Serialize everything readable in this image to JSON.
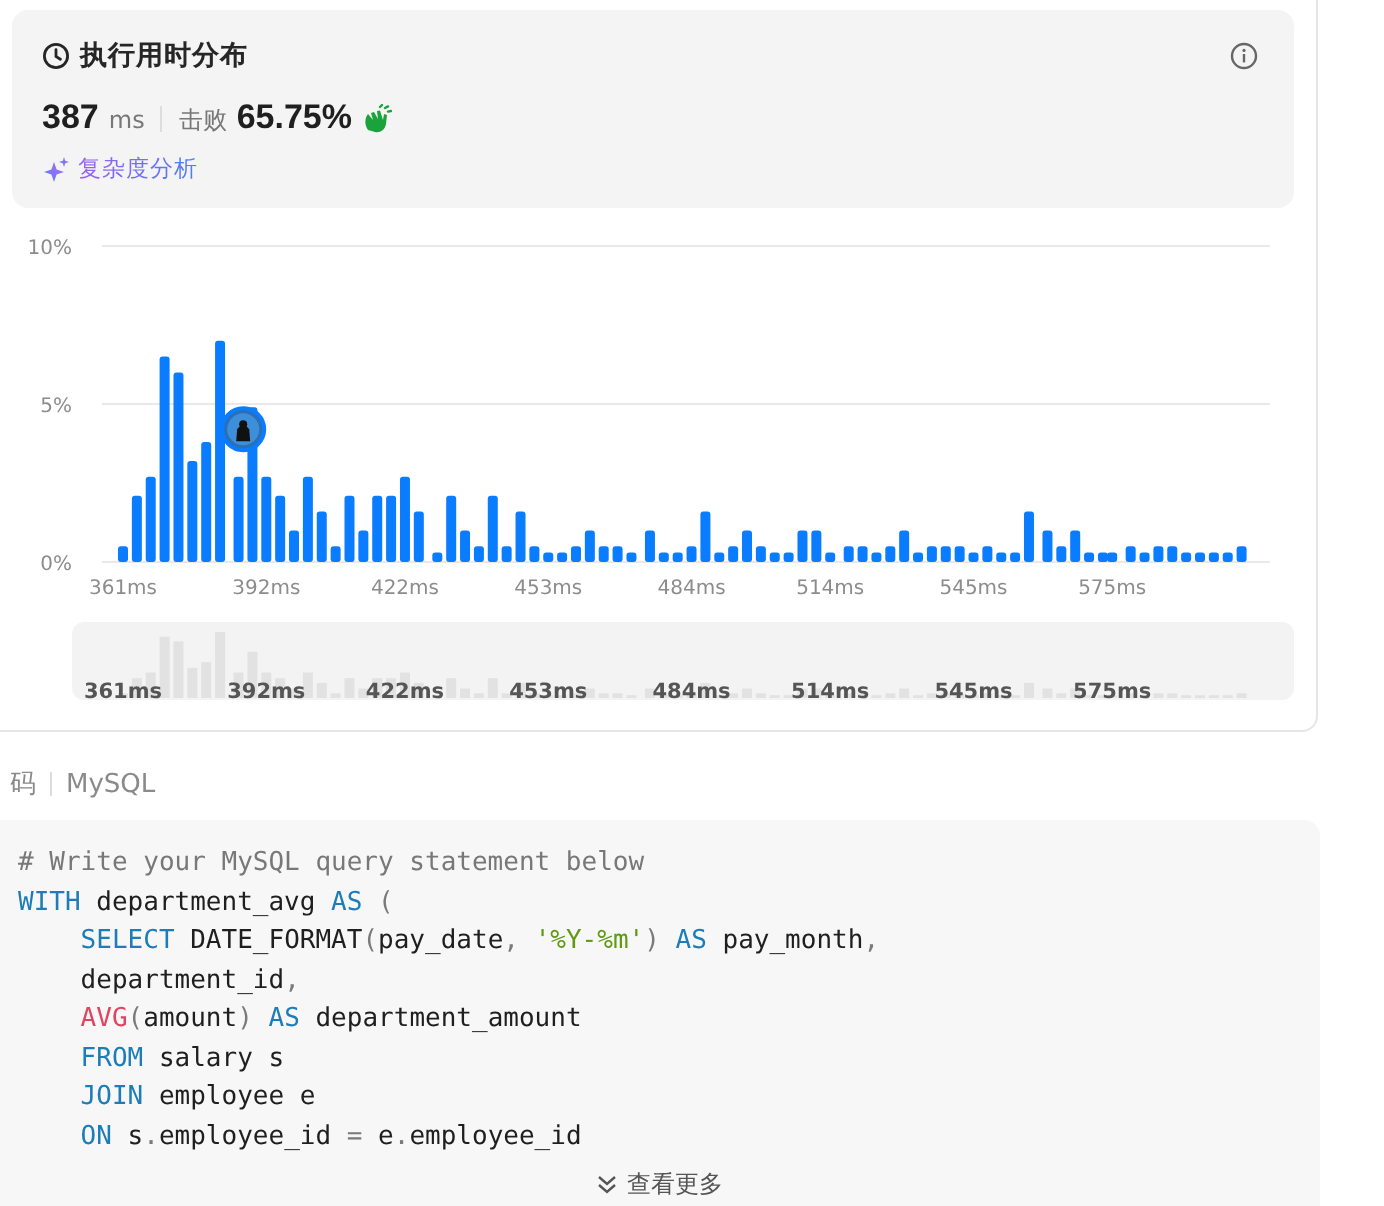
{
  "runtime_panel": {
    "title": "执行用时分布",
    "runtime": "387",
    "unit": "ms",
    "beats_label": "击败",
    "beats": "65.75%",
    "analysis_link": "复杂度分析"
  },
  "chart_data": {
    "type": "bar",
    "yticks": [
      {
        "value": 0,
        "label": "0%"
      },
      {
        "value": 5,
        "label": "5%"
      },
      {
        "value": 10,
        "label": "10%"
      }
    ],
    "ylim": [
      0,
      10
    ],
    "xlim": [
      361,
      603
    ],
    "xticks": [
      {
        "value": 361,
        "label": "361ms"
      },
      {
        "value": 392,
        "label": "392ms"
      },
      {
        "value": 422,
        "label": "422ms"
      },
      {
        "value": 453,
        "label": "453ms"
      },
      {
        "value": 484,
        "label": "484ms"
      },
      {
        "value": 514,
        "label": "514ms"
      },
      {
        "value": 545,
        "label": "545ms"
      },
      {
        "value": 575,
        "label": "575ms"
      }
    ],
    "x": [
      361,
      364,
      367,
      370,
      373,
      376,
      379,
      382,
      386,
      389,
      392,
      395,
      398,
      401,
      404,
      407,
      410,
      413,
      416,
      419,
      422,
      425,
      429,
      432,
      435,
      438,
      441,
      444,
      447,
      450,
      453,
      456,
      459,
      462,
      465,
      468,
      471,
      475,
      478,
      481,
      484,
      487,
      490,
      493,
      496,
      499,
      502,
      505,
      508,
      511,
      514,
      518,
      521,
      524,
      527,
      530,
      533,
      536,
      539,
      542,
      545,
      548,
      551,
      554,
      557,
      561,
      564,
      567,
      570,
      573,
      575,
      579,
      582,
      585,
      588,
      591,
      594,
      597,
      600,
      603
    ],
    "values": [
      0.5,
      2.1,
      2.7,
      6.5,
      6.0,
      3.2,
      3.8,
      7.0,
      2.7,
      4.9,
      2.7,
      2.1,
      1.0,
      2.7,
      1.6,
      0.5,
      2.1,
      1.0,
      2.1,
      2.1,
      2.7,
      1.6,
      0.3,
      2.1,
      1.0,
      0.5,
      2.1,
      0.5,
      1.6,
      0.5,
      0.3,
      0.3,
      0.5,
      1.0,
      0.5,
      0.5,
      0.3,
      1.0,
      0.3,
      0.3,
      0.5,
      1.6,
      0.3,
      0.5,
      1.0,
      0.5,
      0.3,
      0.3,
      1.0,
      1.0,
      0.3,
      0.5,
      0.5,
      0.3,
      0.5,
      1.0,
      0.3,
      0.5,
      0.5,
      0.5,
      0.3,
      0.5,
      0.3,
      0.3,
      1.6,
      1.0,
      0.5,
      1.0,
      0.3,
      0.3,
      0.3,
      0.5,
      0.3,
      0.5,
      0.5,
      0.3,
      0.3,
      0.3,
      0.3,
      0.5
    ]
  },
  "navigator": {
    "labels": [
      "361ms",
      "392ms",
      "422ms",
      "453ms",
      "484ms",
      "514ms",
      "545ms",
      "575ms"
    ]
  },
  "code_header": {
    "title": "码",
    "language": "MySQL"
  },
  "code_lines": [
    {
      "tokens": [
        {
          "kind": "comment",
          "text": "# Write your MySQL query statement below"
        }
      ]
    },
    {
      "tokens": [
        {
          "kind": "keyword",
          "text": "WITH"
        },
        {
          "kind": "plain",
          "text": " department_avg "
        },
        {
          "kind": "keyword",
          "text": "AS"
        },
        {
          "kind": "punct",
          "text": " ("
        }
      ]
    },
    {
      "tokens": [
        {
          "kind": "keyword",
          "text": "    SELECT"
        },
        {
          "kind": "plain",
          "text": " DATE_FORMAT"
        },
        {
          "kind": "punct",
          "text": "("
        },
        {
          "kind": "plain",
          "text": "pay_date"
        },
        {
          "kind": "punct",
          "text": ", "
        },
        {
          "kind": "string",
          "text": "'%Y-%m'"
        },
        {
          "kind": "punct",
          "text": ")"
        },
        {
          "kind": "keyword",
          "text": " AS"
        },
        {
          "kind": "plain",
          "text": " pay_month"
        },
        {
          "kind": "punct",
          "text": ","
        }
      ]
    },
    {
      "tokens": [
        {
          "kind": "plain",
          "text": "    department_id"
        },
        {
          "kind": "punct",
          "text": ","
        }
      ]
    },
    {
      "tokens": [
        {
          "kind": "function",
          "text": "    AVG"
        },
        {
          "kind": "punct",
          "text": "("
        },
        {
          "kind": "plain",
          "text": "amount"
        },
        {
          "kind": "punct",
          "text": ")"
        },
        {
          "kind": "keyword",
          "text": " AS"
        },
        {
          "kind": "plain",
          "text": " department_amount"
        }
      ]
    },
    {
      "tokens": [
        {
          "kind": "keyword",
          "text": "    FROM"
        },
        {
          "kind": "plain",
          "text": " salary s"
        }
      ]
    },
    {
      "tokens": [
        {
          "kind": "keyword",
          "text": "    JOIN"
        },
        {
          "kind": "plain",
          "text": " employee e"
        }
      ]
    },
    {
      "tokens": [
        {
          "kind": "keyword",
          "text": "    ON"
        },
        {
          "kind": "plain",
          "text": " s"
        },
        {
          "kind": "punct",
          "text": "."
        },
        {
          "kind": "plain",
          "text": "employee_id "
        },
        {
          "kind": "punct",
          "text": "="
        },
        {
          "kind": "plain",
          "text": " e"
        },
        {
          "kind": "punct",
          "text": "."
        },
        {
          "kind": "plain",
          "text": "employee_id"
        }
      ]
    }
  ],
  "show_more": "查看更多"
}
